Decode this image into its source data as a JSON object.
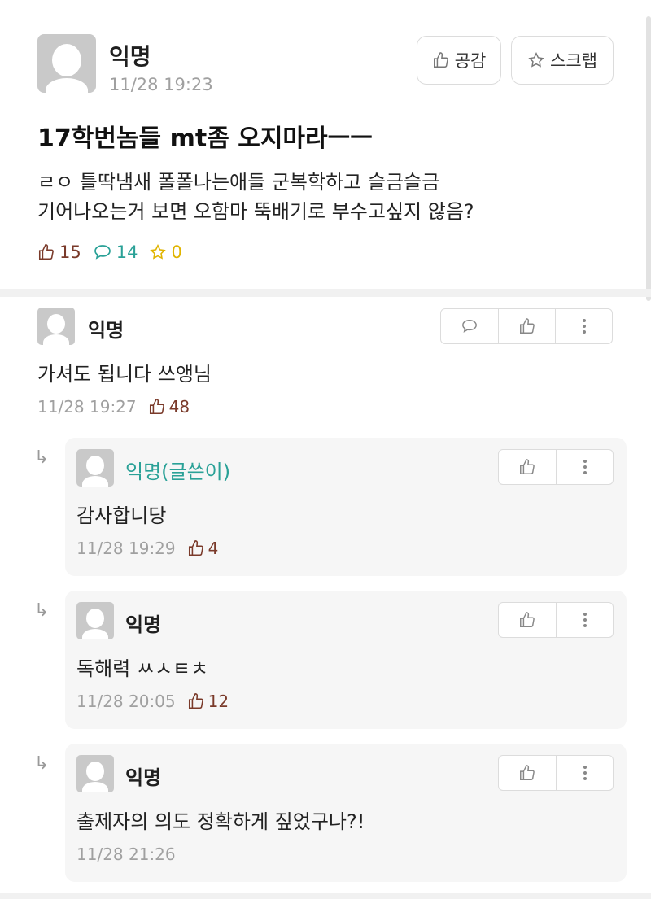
{
  "post": {
    "author": "익명",
    "time": "11/28 19:23",
    "buttons": {
      "like": "공감",
      "scrap": "스크랩"
    },
    "title": "17학번놈들 mt좀 오지마라ㅡㅡ",
    "content_lines": [
      "ㄹㅇ 틀딱냄새 폴폴나는애들 군복학하고 슬금슬금",
      "기어나오는거 보면 오함마 뚝배기로 부수고싶지 않음?"
    ],
    "stats": {
      "likes": "15",
      "comments": "14",
      "scraps": "0"
    },
    "colors": {
      "like": "#7a3a2a",
      "comment": "#2aa197",
      "scrap": "#e0b400"
    }
  },
  "comments": [
    {
      "author": "익명",
      "text": "가셔도 됩니다 쓰앵님",
      "time": "11/28 19:27",
      "likes": "48",
      "replies": [
        {
          "author": "익명(글쓴이)",
          "text": "감사합니당",
          "time": "11/28 19:29",
          "likes": "4"
        },
        {
          "author": "익명",
          "text": "독해력 ㅆㅅㅌㅊ",
          "time": "11/28 20:05",
          "likes": "12"
        },
        {
          "author": "익명",
          "text": "출제자의 의도 정확하게 짚었구나?!",
          "time": "11/28 21:26",
          "likes": ""
        }
      ]
    }
  ],
  "icons": {
    "reply_arrow": "↳",
    "like": "thumbs-up-icon",
    "comment": "speech-bubble-icon",
    "scrap": "star-icon",
    "more": "vertical-dots-icon"
  }
}
